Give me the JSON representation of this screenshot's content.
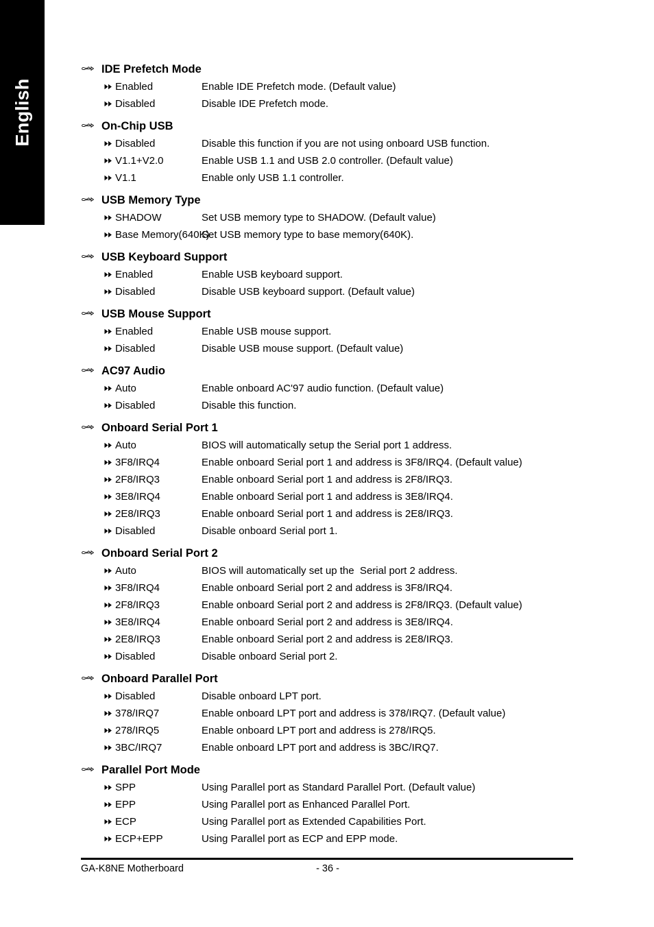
{
  "language_tab": {
    "label": "English"
  },
  "icons": {
    "section_marker": "pointing-hand-icon",
    "option_marker": "double-triangle-right-icon"
  },
  "sections": [
    {
      "title": "IDE Prefetch Mode",
      "options": [
        {
          "name": "Enabled",
          "desc": "Enable IDE Prefetch mode. (Default value)"
        },
        {
          "name": "Disabled",
          "desc": "Disable IDE Prefetch mode."
        }
      ]
    },
    {
      "title": "On-Chip USB",
      "options": [
        {
          "name": "Disabled",
          "desc": "Disable this function if you are not using onboard USB function."
        },
        {
          "name": "V1.1+V2.0",
          "desc": "Enable USB 1.1 and USB 2.0 controller. (Default value)"
        },
        {
          "name": "V1.1",
          "desc": "Enable only USB 1.1 controller."
        }
      ]
    },
    {
      "title": "USB Memory Type",
      "options": [
        {
          "name": "SHADOW",
          "desc": "Set USB memory type to SHADOW. (Default value)"
        },
        {
          "name": "Base Memory(640K)",
          "desc": "Set USB memory type to base memory(640K)."
        }
      ]
    },
    {
      "title": "USB Keyboard Support",
      "options": [
        {
          "name": "Enabled",
          "desc": "Enable USB keyboard support."
        },
        {
          "name": "Disabled",
          "desc": "Disable USB keyboard support. (Default value)"
        }
      ]
    },
    {
      "title": "USB Mouse Support",
      "options": [
        {
          "name": "Enabled",
          "desc": "Enable USB mouse support."
        },
        {
          "name": "Disabled",
          "desc": "Disable USB mouse support. (Default value)"
        }
      ]
    },
    {
      "title": "AC97 Audio",
      "options": [
        {
          "name": "Auto",
          "desc": "Enable onboard AC'97 audio function. (Default value)"
        },
        {
          "name": "Disabled",
          "desc": "Disable this function."
        }
      ]
    },
    {
      "title": "Onboard Serial Port 1",
      "options": [
        {
          "name": "Auto",
          "desc": "BIOS will automatically setup the Serial port 1 address."
        },
        {
          "name": "3F8/IRQ4",
          "desc": "Enable onboard Serial port 1 and address is 3F8/IRQ4. (Default value)"
        },
        {
          "name": "2F8/IRQ3",
          "desc": "Enable onboard Serial port 1 and address is 2F8/IRQ3."
        },
        {
          "name": "3E8/IRQ4",
          "desc": "Enable onboard Serial port 1 and address is 3E8/IRQ4."
        },
        {
          "name": "2E8/IRQ3",
          "desc": "Enable onboard Serial port 1 and address is 2E8/IRQ3."
        },
        {
          "name": "Disabled",
          "desc": "Disable onboard Serial port 1."
        }
      ]
    },
    {
      "title": "Onboard Serial Port 2",
      "options": [
        {
          "name": "Auto",
          "desc": "BIOS will automatically set up the  Serial port 2 address."
        },
        {
          "name": "3F8/IRQ4",
          "desc": "Enable onboard Serial port 2 and address is 3F8/IRQ4."
        },
        {
          "name": "2F8/IRQ3",
          "desc": "Enable onboard Serial port 2 and address is 2F8/IRQ3. (Default value)"
        },
        {
          "name": "3E8/IRQ4",
          "desc": "Enable onboard Serial port 2 and address is 3E8/IRQ4."
        },
        {
          "name": "2E8/IRQ3",
          "desc": "Enable onboard Serial port 2 and address is 2E8/IRQ3."
        },
        {
          "name": "Disabled",
          "desc": "Disable onboard Serial port 2."
        }
      ]
    },
    {
      "title": "Onboard Parallel Port",
      "options": [
        {
          "name": "Disabled",
          "desc": "Disable onboard LPT port."
        },
        {
          "name": "378/IRQ7",
          "desc": "Enable onboard LPT port and address is 378/IRQ7. (Default value)"
        },
        {
          "name": "278/IRQ5",
          "desc": "Enable onboard LPT port and address is 278/IRQ5."
        },
        {
          "name": "3BC/IRQ7",
          "desc": "Enable onboard LPT port and address is 3BC/IRQ7."
        }
      ]
    },
    {
      "title": "Parallel Port Mode",
      "options": [
        {
          "name": "SPP",
          "desc": "Using Parallel port as Standard Parallel Port. (Default value)"
        },
        {
          "name": "EPP",
          "desc": "Using Parallel port as Enhanced Parallel Port."
        },
        {
          "name": "ECP",
          "desc": "Using Parallel port as Extended Capabilities Port."
        },
        {
          "name": "ECP+EPP",
          "desc": "Using Parallel port as ECP and EPP mode."
        }
      ]
    }
  ],
  "footer": {
    "product": "GA-K8NE Motherboard",
    "page_number": "- 36 -"
  }
}
